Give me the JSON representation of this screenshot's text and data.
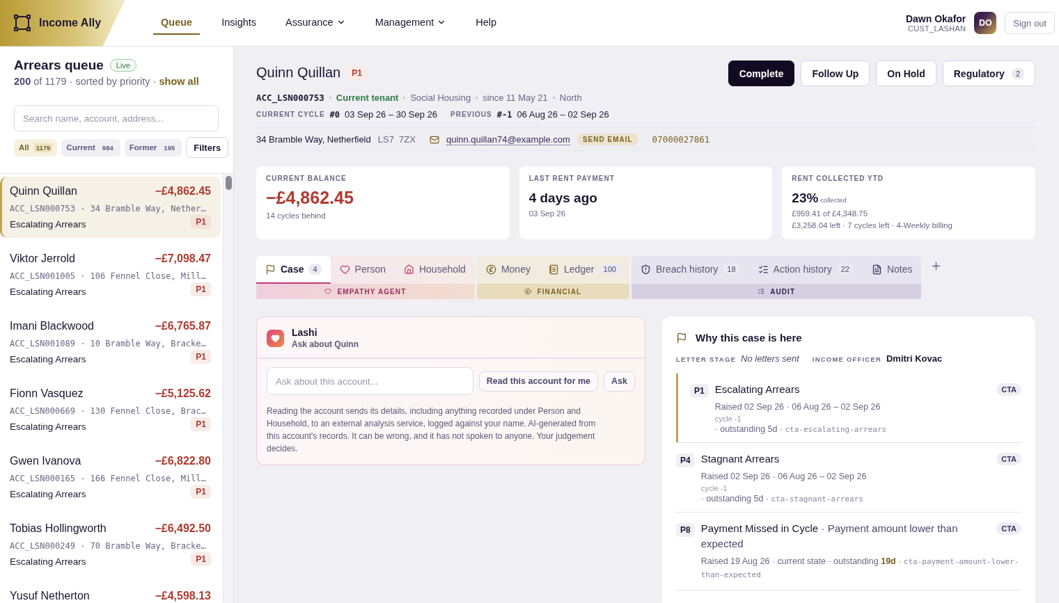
{
  "header": {
    "brand": "Income Ally",
    "nav": [
      {
        "label": "Queue",
        "selected": true,
        "has_menu": false
      },
      {
        "label": "Insights",
        "selected": false,
        "has_menu": false
      },
      {
        "label": "Assurance",
        "selected": false,
        "has_menu": true
      },
      {
        "label": "Management",
        "selected": false,
        "has_menu": true
      },
      {
        "label": "Help",
        "selected": false,
        "has_menu": false
      }
    ],
    "user": {
      "name": "Dawn Okafor",
      "id": "CUST_LASHAN",
      "initials": "DO"
    },
    "sign_out": "Sign out"
  },
  "sidebar": {
    "title": "Arrears queue",
    "live_badge": "Live",
    "summary": "**200** of 1179 · sorted by priority ·",
    "show_all": "show all",
    "search": {
      "placeholder": "Search name, account, address..."
    },
    "filters": [
      {
        "label": "All",
        "count": "1179",
        "selected": true
      },
      {
        "label": "Current",
        "count": "984",
        "selected": false
      },
      {
        "label": "Former",
        "count": "195",
        "selected": false
      }
    ],
    "filters_button": "Filters",
    "queue": [
      {
        "name": "Quinn Quillan",
        "amount": "−£4,862.45",
        "account": "ACC_LSN000753 · 34 Bramble Way, Nether…",
        "status": "Escalating Arrears",
        "priority": "P1",
        "selected": true
      },
      {
        "name": "Viktor Jerrold",
        "amount": "−£7,098.47",
        "account": "ACC_LSN001005 · 106 Fennel Close, Mill…",
        "status": "Escalating Arrears",
        "priority": "P1",
        "selected": false
      },
      {
        "name": "Imani Blackwood",
        "amount": "−£6,765.87",
        "account": "ACC_LSN001089 · 10 Bramble Way, Bracke…",
        "status": "Escalating Arrears",
        "priority": "P1",
        "selected": false
      },
      {
        "name": "Fionn Vasquez",
        "amount": "−£5,125.62",
        "account": "ACC_LSN000669 · 130 Fennel Close, Brac…",
        "status": "Escalating Arrears",
        "priority": "P1",
        "selected": false
      },
      {
        "name": "Gwen Ivanova",
        "amount": "−£6,822.80",
        "account": "ACC_LSN000165 · 166 Fennel Close, Mill…",
        "status": "Escalating Arrears",
        "priority": "P1",
        "selected": false
      },
      {
        "name": "Tobias Hollingworth",
        "amount": "−£6,492.50",
        "account": "ACC_LSN000249 · 70 Bramble Way, Bracke…",
        "status": "Escalating Arrears",
        "priority": "P1",
        "selected": false
      },
      {
        "name": "Yusuf Netherton",
        "amount": "−£4,598.13",
        "selected": false
      }
    ]
  },
  "case": {
    "name": "Quinn Quillan",
    "priority": "P1",
    "actions": [
      {
        "label": "Complete",
        "kind": "primary"
      },
      {
        "label": "Follow Up",
        "kind": "outline"
      },
      {
        "label": "On Hold",
        "kind": "outline"
      },
      {
        "label": "Regulatory",
        "kind": "outline",
        "count": "2"
      }
    ],
    "account": "ACC_LSN000753",
    "tenancy": "Current tenant",
    "details": [
      "Social Housing",
      "since 11 May 21",
      "North"
    ],
    "cycles": [
      {
        "label": "CURRENT CYCLE",
        "number": "#0",
        "range": "03 Sep 26 – 30 Sep 26"
      },
      {
        "label": "PREVIOUS",
        "number": "#-1",
        "range": "06 Aug 26 – 02 Sep 26"
      }
    ],
    "contact": {
      "address": "34 Bramble Way, Netherfield",
      "postcode": "LS7  7ZX",
      "email": "quinn.quillan74@example.com",
      "send_email": "SEND EMAIL",
      "phone": "07000027861"
    },
    "stats": [
      {
        "kind": "balance",
        "label": "CURRENT BALANCE",
        "value": "−£4,862.45",
        "lines": [
          "14 cycles behind"
        ]
      },
      {
        "kind": "plain",
        "label": "LAST RENT PAYMENT",
        "value": "4 days ago",
        "lines": [
          "03 Sep 26"
        ]
      },
      {
        "kind": "percent",
        "label": "RENT COLLECTED YTD",
        "value": "23%",
        "unit": "collected",
        "lines": [
          "£959.41 of £4,348.75",
          "£3,258.04 left · 7 cycles left · 4-Weekly billing"
        ]
      }
    ],
    "tab_groups": [
      {
        "kind": "empathy",
        "label": "EMPATHY AGENT",
        "tabs": [
          {
            "label": "Case",
            "count": "4",
            "selected": true
          },
          {
            "label": "Person",
            "selected": false
          },
          {
            "label": "Household",
            "selected": false
          }
        ]
      },
      {
        "kind": "financial",
        "label": "FINANCIAL",
        "tabs": [
          {
            "label": "Money",
            "selected": false
          },
          {
            "label": "Ledger",
            "count": "100",
            "selected": false
          }
        ]
      },
      {
        "kind": "audit",
        "label": "AUDIT",
        "tabs": [
          {
            "label": "Breach history",
            "count": "18",
            "selected": false
          },
          {
            "label": "Action history",
            "count": "22",
            "selected": false
          },
          {
            "label": "Notes",
            "selected": false
          }
        ]
      }
    ],
    "assistant": {
      "name": "Lashi",
      "subtitle": "Ask about Quinn",
      "placeholder": "Ask about this account...",
      "read_button": "Read this account for me",
      "ask_button": "Ask",
      "disclaimer": "Reading the account sends its details, including anything recorded under Person and Household, to an external analysis service, logged against your name. AI-generated from this account's records. It can be wrong, and it has not spoken to anyone. Your judgement decides."
    },
    "reasons": {
      "title": "Why this case is here",
      "letter_stage_label": "LETTER STAGE",
      "letter_stage": "No letters sent",
      "officer_label": "INCOME OFFICER",
      "officer": "Dmitri Kovac",
      "items": [
        {
          "priority": "P1",
          "title": "Escalating Arrears",
          "tag": "CTA",
          "meta": "Raised 02 Sep 26 · 06 Aug 26 – 02 Sep 26",
          "cycle": "cycle -1",
          "tail": "· outstanding 5d ·",
          "code": "cta-escalating-arrears",
          "selected": true
        },
        {
          "priority": "P4",
          "title": "Stagnant Arrears",
          "tag": "CTA",
          "meta": "Raised 02 Sep 26 · 06 Aug 26 – 02 Sep 26",
          "cycle": "cycle -1",
          "tail": "· outstanding 5d ·",
          "code": "cta-stagnant-arrears",
          "selected": false
        },
        {
          "priority": "P8",
          "title": "Payment Missed in Cycle",
          "detail": "· Payment amount lower than expected",
          "tag": "CTA",
          "meta": "Raised 19 Aug 26 · current state · outstanding **19d** ·",
          "code": "cta-payment-amount-lower-than-expected",
          "selected": false
        }
      ]
    }
  }
}
